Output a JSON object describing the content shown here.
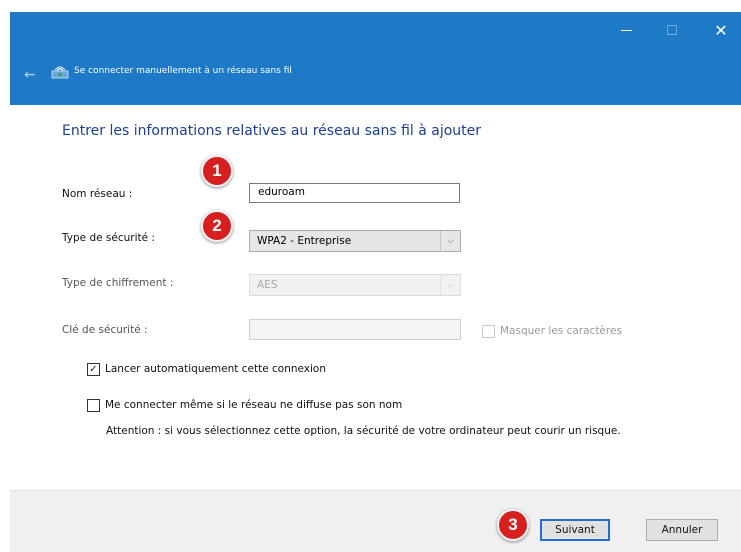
{
  "window": {
    "title": "Se connecter manuellement à un réseau sans fil",
    "close_glyph": "✕",
    "back_glyph": "←"
  },
  "form": {
    "heading": "Entrer les informations relatives au réseau sans fil à ajouter",
    "network_name": {
      "label": "Nom réseau :",
      "value": "eduroam"
    },
    "security_type": {
      "label": "Type de sécurité :",
      "value": "WPA2 - Entreprise"
    },
    "encryption_type": {
      "label": "Type de chiffrement :",
      "value": "AES"
    },
    "security_key": {
      "label": "Clé de sécurité :",
      "value": ""
    },
    "hide_characters": {
      "label": "Masquer les caractères",
      "checked": false
    },
    "auto_connect": {
      "label": "Lancer automatiquement cette connexion",
      "checked": true,
      "check_glyph": "✓"
    },
    "connect_hidden": {
      "label": "Me connecter même si le réseau ne diffuse pas son nom",
      "checked": false
    },
    "warning": "Attention : si vous sélectionnez cette option, la sécurité de votre ordinateur peut courir un risque.",
    "dropdown_glyph": "⌵"
  },
  "buttons": {
    "next": "Suivant",
    "cancel": "Annuler"
  },
  "badges": [
    "1",
    "2",
    "3"
  ],
  "colors": {
    "titlebar": "#1e79c7",
    "heading": "#1c3f95",
    "badge": "#d61f1f",
    "focus": "#1e6fcf"
  }
}
